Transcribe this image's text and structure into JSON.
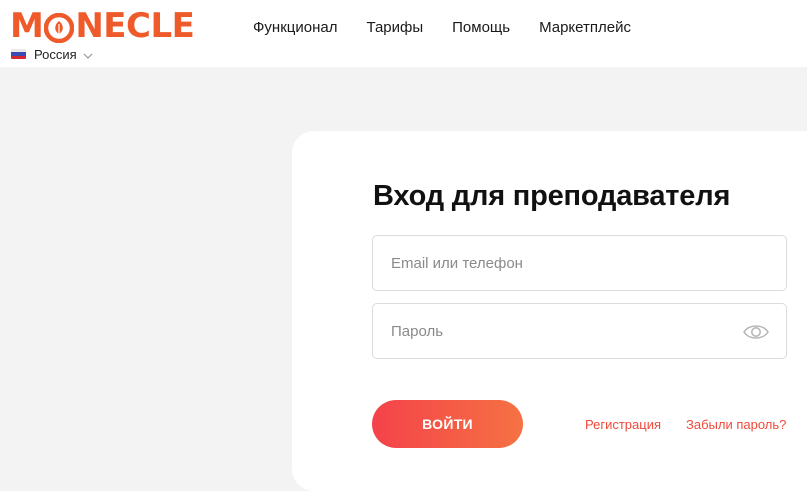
{
  "brand": {
    "logo_m": "M",
    "logo_o": "O",
    "logo_rest": "NECLE",
    "color": "#ef5a2b"
  },
  "header": {
    "country": "Россия",
    "nav": [
      {
        "label": "Функционал"
      },
      {
        "label": "Тарифы"
      },
      {
        "label": "Помощь"
      },
      {
        "label": "Маркетплейс"
      }
    ]
  },
  "login": {
    "title": "Вход для преподавателя",
    "email_placeholder": "Email или телефон",
    "password_placeholder": "Пароль",
    "submit_label": "ВОЙТИ",
    "register_link": "Регистрация",
    "forgot_link": "Забыли пароль?"
  },
  "icons": {
    "flag": "russia-flag-icon",
    "chevron": "chevron-down-icon",
    "eye": "eye-icon",
    "logo_mark": "leaf-circle-icon"
  },
  "colors": {
    "accent": "#ef4a3a",
    "button_gradient_start": "#f4424a",
    "button_gradient_end": "#f57243",
    "page_background": "#f3f3f3"
  }
}
